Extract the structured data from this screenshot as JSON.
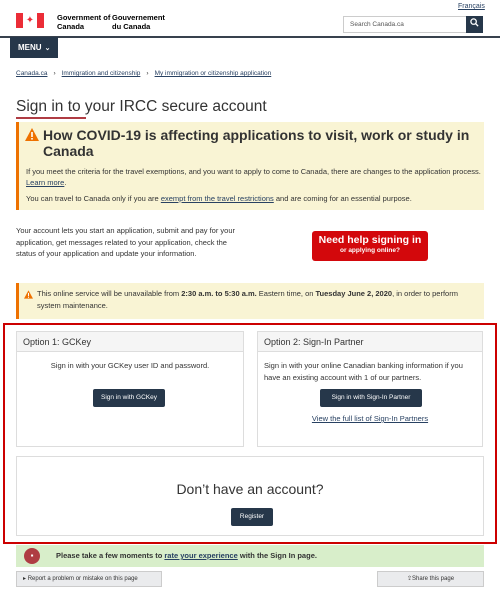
{
  "header": {
    "gov_en": "Government of Canada",
    "gov_fr": "Gouvernement du Canada",
    "language_link": "Français",
    "search_placeholder": "Search Canada.ca",
    "menu_label": "MENU"
  },
  "breadcrumb": [
    "Canada.ca",
    "Immigration and citizenship",
    "My immigration or citizenship application"
  ],
  "page_title": "Sign in to your IRCC secure account",
  "covid_alert": {
    "heading": "How COVID-19 is affecting applications to visit, work or study in Canada",
    "p1_text": "If you meet the criteria for the travel exemptions, and you want to apply to come to Canada, there are changes to the application process.",
    "p1_link": "Learn more",
    "p2_pre": "You can travel to Canada only if you are",
    "p2_link": "exempt from the travel restrictions",
    "p2_post": "and are coming for an essential purpose."
  },
  "intro": "Your account lets you start an application, submit and pay for your application, get messages related to your application, check the status of your application and update your information.",
  "help_button": {
    "line1": "Need help signing in",
    "line2": "or applying online?"
  },
  "outage": {
    "pre": "This online service will be unavailable from",
    "time": "2:30 a.m. to 5:30 a.m.",
    "mid": "Eastern time, on",
    "date": "Tuesday June 2, 2020",
    "post": ", in order to perform system maintenance."
  },
  "option1": {
    "title": "Option 1: GCKey",
    "text": "Sign in with your GCKey user ID and password.",
    "button": "Sign in with GCKey"
  },
  "option2": {
    "title": "Option 2: Sign-In Partner",
    "text": "Sign in with your online Canadian banking information if you have an existing account with 1 of our partners.",
    "button": "Sign in with Sign-In Partner",
    "link": "View the full list of Sign-In Partners"
  },
  "no_account": {
    "title": "Don’t have an account?",
    "button": "Register"
  },
  "feedback": {
    "pre": "Please take a few moments to",
    "link": "rate your experience",
    "post": "with the Sign In page."
  },
  "footer": {
    "report": "Report a problem or mistake on this page",
    "share": "Share this page"
  },
  "colors": {
    "accent_red": "#d3080c",
    "navy": "#26374a",
    "alert_bg": "#f9f4d4",
    "alert_border": "#ee7100",
    "frame_red": "#c00000"
  }
}
